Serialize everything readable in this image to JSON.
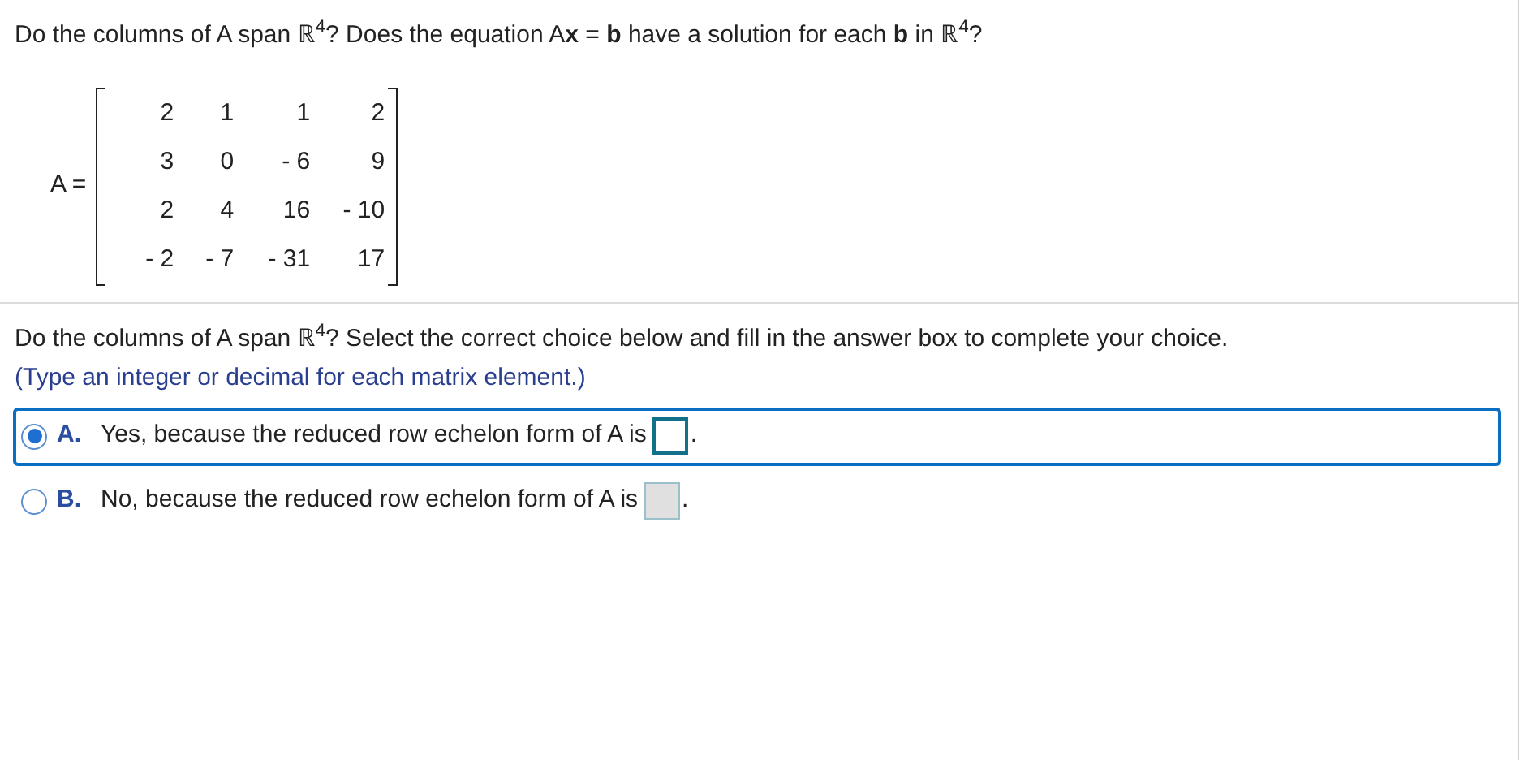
{
  "question": "Do the columns of A span ℝ$^{4}$? Does the equation A**x** = **b** have a solution for each **b** in ℝ$^{4}$?",
  "matrix": {
    "label": "A =",
    "rows": [
      [
        "2",
        "1",
        "1",
        "2"
      ],
      [
        "3",
        "0",
        "- 6",
        "9"
      ],
      [
        "2",
        "4",
        "16",
        "- 10"
      ],
      [
        "- 2",
        "- 7",
        "- 31",
        "17"
      ]
    ]
  },
  "prompt": "Do the columns of A span ℝ$^{4}$? Select the correct choice below and fill in the answer box to complete your choice.",
  "hint": "(Type an integer or decimal for each matrix element.)",
  "choices": [
    {
      "letter": "A.",
      "text": "Yes, because the reduced row echelon form of A is",
      "suffix": ".",
      "selected": true
    },
    {
      "letter": "B.",
      "text": "No, because the reduced row echelon form of A is",
      "suffix": ".",
      "selected": false
    }
  ]
}
